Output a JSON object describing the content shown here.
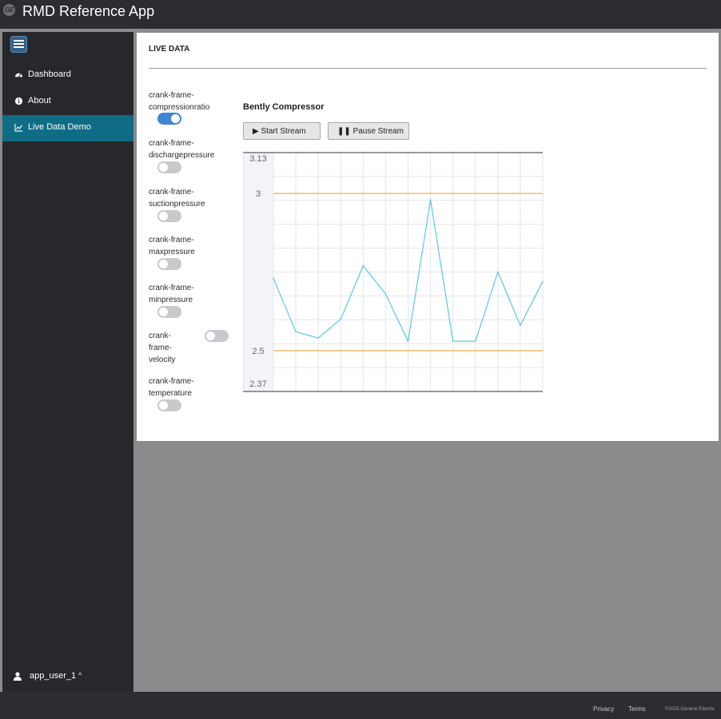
{
  "header": {
    "app_title": "RMD Reference App",
    "logo_text": "GE",
    "logo_icon": "ge-logo-icon"
  },
  "sidebar": {
    "menu_icon": "hamburger-menu-icon",
    "items": [
      {
        "label": "Dashboard",
        "icon": "dashboard-gauge-icon",
        "active": false
      },
      {
        "label": "About",
        "icon": "info-circle-icon",
        "active": false
      },
      {
        "label": "Live Data Demo",
        "icon": "line-chart-icon",
        "active": true
      }
    ],
    "user": {
      "name": "app_user_1",
      "icon": "user-icon",
      "caret": "^"
    }
  },
  "panel": {
    "title": "LIVE DATA",
    "sensors": [
      {
        "label": "crank-frame-\ncompressionratio",
        "on": true
      },
      {
        "label": "crank-frame-\ndischargepressure",
        "on": false
      },
      {
        "label": "crank-frame-\nsuctionpressure",
        "on": false
      },
      {
        "label": "crank-frame-\nmaxpressure",
        "on": false
      },
      {
        "label": "crank-frame-\nminpressure",
        "on": false
      },
      {
        "label": "crank-\nframe-\nvelocity",
        "on": false
      },
      {
        "label": "crank-frame-\ntemperature",
        "on": false
      }
    ],
    "chart_title": "Bently Compressor",
    "start_button": "▶ Start Stream",
    "pause_button": "❚❚ Pause Stream"
  },
  "chart_data": {
    "type": "line",
    "title": "Bently Compressor",
    "xlabel": "",
    "ylabel": "",
    "ylim": [
      2.37,
      3.13
    ],
    "y_ticks": [
      "3.13",
      "3",
      "2.5",
      "2.37"
    ],
    "thresholds": [
      3.0,
      2.5
    ],
    "grid": true,
    "series": [
      {
        "values": [
          2.73,
          2.56,
          2.54,
          2.6,
          2.77,
          2.68,
          2.53,
          2.98,
          2.53,
          2.53,
          2.75,
          2.58,
          2.72
        ]
      }
    ],
    "colors": {
      "line": "#5bc8e0",
      "threshold": "#f0ad55",
      "grid": "#e6e6e6"
    }
  },
  "footer": {
    "privacy": "Privacy",
    "terms": "Terms",
    "copyright": "©2015 General Electric"
  }
}
